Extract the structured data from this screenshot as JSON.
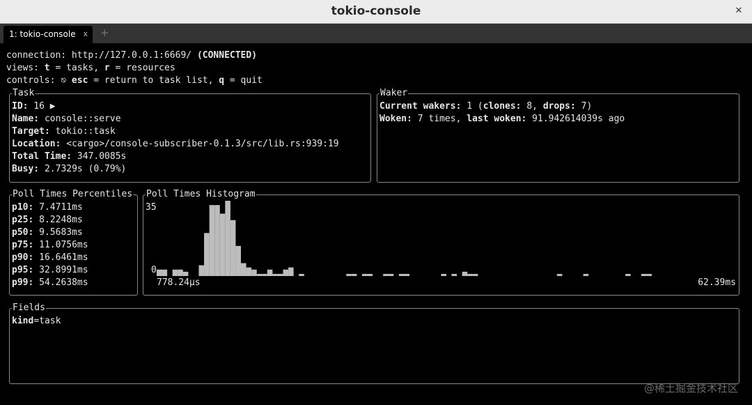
{
  "window": {
    "title": "tokio-console"
  },
  "tabs": [
    {
      "label": "1: tokio-console",
      "close": "x"
    }
  ],
  "new_tab": "+",
  "header": {
    "line1": {
      "prefix": "connection: http://127.0.0.1:6669/ ",
      "status": "(CONNECTED)"
    },
    "line2": {
      "a": "views: ",
      "t_key": "t",
      "b": " = tasks, ",
      "r_key": "r",
      "c": " = resources"
    },
    "line3": {
      "a": "controls: ⎋ ",
      "esc_key": "esc",
      "b": " = return to task list, ",
      "q_key": "q",
      "c": " = quit"
    }
  },
  "task": {
    "title": "Task",
    "id_label": "ID:",
    "id_value": " 16 ▶",
    "name_label": "Name:",
    "name_value": " console::serve",
    "target_label": "Target:",
    "target_value": " tokio::task",
    "location_label": "Location:",
    "location_value": " <cargo>/console-subscriber-0.1.3/src/lib.rs:939:19",
    "total_label": "Total Time:",
    "total_value": " 347.0085s",
    "busy_label": "Busy:",
    "busy_value": " 2.7329s (0.79%)"
  },
  "waker": {
    "title": "Waker",
    "current_label": "Current wakers:",
    "current_value": " 1 (",
    "clones_label": "clones:",
    "clones_value": " 8, ",
    "drops_label": "drops:",
    "drops_value": " 7)",
    "woken_label": "Woken:",
    "woken_value": " 7 times, ",
    "last_label": "last woken:",
    "last_value": " 91.942614039s ago"
  },
  "percentiles": {
    "title": "Poll Times Percentiles",
    "items": [
      {
        "label": "p10:",
        "value": " 7.4711ms"
      },
      {
        "label": "p25:",
        "value": " 8.2248ms"
      },
      {
        "label": "p50:",
        "value": " 9.5683ms"
      },
      {
        "label": "p75:",
        "value": " 11.0756ms"
      },
      {
        "label": "p90:",
        "value": " 16.6461ms"
      },
      {
        "label": "p95:",
        "value": " 32.8991ms"
      },
      {
        "label": "p99:",
        "value": " 54.2638ms"
      }
    ]
  },
  "histogram": {
    "title": "Poll Times Histogram"
  },
  "chart_data": {
    "type": "bar",
    "y_max_label": "35",
    "y_min_label": "0",
    "x_min_label": "778.24µs",
    "x_max_label": "62.39ms",
    "ylim": [
      0,
      35
    ],
    "bar_color": "#bdbdbd",
    "values": [
      3,
      3,
      0,
      3,
      3,
      2,
      0,
      0,
      5,
      20,
      33,
      33,
      29,
      35,
      26,
      14,
      6,
      4,
      3,
      1,
      1,
      3,
      1,
      1,
      3,
      4,
      0,
      1,
      0,
      0,
      0,
      0,
      0,
      0,
      0,
      0,
      1,
      1,
      0,
      1,
      1,
      0,
      0,
      1,
      1,
      0,
      1,
      1,
      0,
      0,
      0,
      0,
      0,
      0,
      1,
      0,
      1,
      0,
      2,
      1,
      1,
      0,
      0,
      0,
      0,
      0,
      0,
      0,
      0,
      0,
      0,
      0,
      0,
      0,
      0,
      0,
      1,
      0,
      0,
      0,
      0,
      1,
      0,
      0,
      0,
      0,
      0,
      0,
      0,
      1,
      0,
      0,
      1,
      1,
      0,
      0,
      0,
      0,
      0,
      0,
      0,
      0,
      0,
      0,
      0,
      0,
      0,
      0,
      0,
      0
    ]
  },
  "fields": {
    "title": "Fields",
    "key": "kind",
    "value": "=task"
  },
  "watermark": "@稀土掘金技术社区"
}
